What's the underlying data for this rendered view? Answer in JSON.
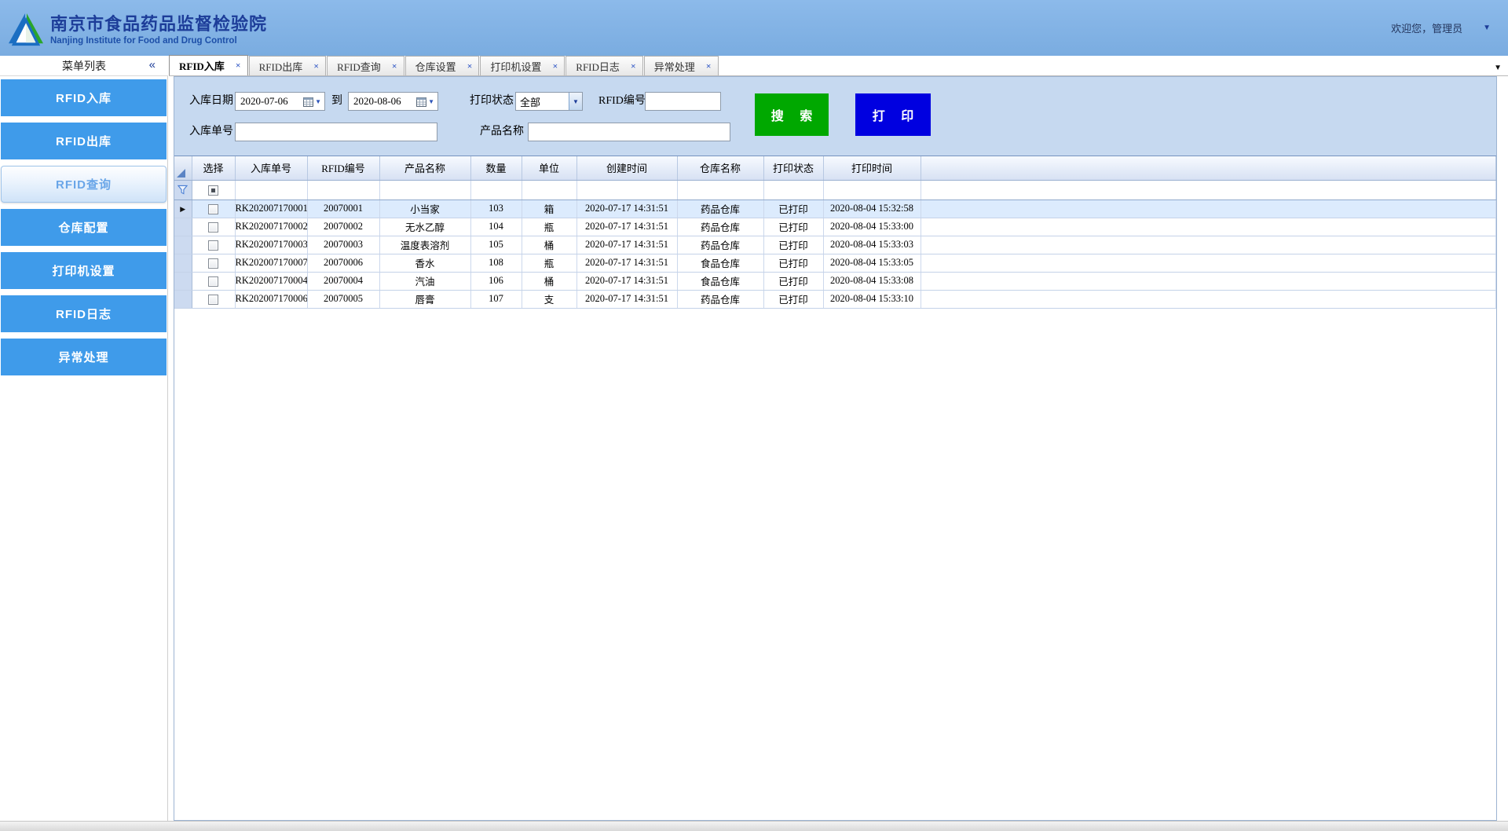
{
  "header": {
    "title": "南京市食品药品监督检验院",
    "subtitle": "Nanjing Institute for Food and Drug Control",
    "welcome": "欢迎您，管理员"
  },
  "icons": {
    "collapse": "«",
    "user_caret": "▼",
    "tab_overflow": "▼",
    "date_caret": "▼",
    "combo_caret": "▼",
    "current_row": "▶",
    "close": "×"
  },
  "sidebar": {
    "title": "菜单列表",
    "items": [
      {
        "label": "RFID入库",
        "selected": false
      },
      {
        "label": "RFID出库",
        "selected": false
      },
      {
        "label": "RFID查询",
        "selected": true
      },
      {
        "label": "仓库配置",
        "selected": false
      },
      {
        "label": "打印机设置",
        "selected": false
      },
      {
        "label": "RFID日志",
        "selected": false
      },
      {
        "label": "异常处理",
        "selected": false
      }
    ]
  },
  "tabs": [
    {
      "label": "RFID入库",
      "active": true
    },
    {
      "label": "RFID出库",
      "active": false
    },
    {
      "label": "RFID查询",
      "active": false
    },
    {
      "label": "仓库设置",
      "active": false
    },
    {
      "label": "打印机设置",
      "active": false
    },
    {
      "label": "RFID日志",
      "active": false
    },
    {
      "label": "异常处理",
      "active": false
    }
  ],
  "filters": {
    "date_label": "入库日期",
    "date_from": "2020-07-06",
    "to_label": "到",
    "date_to": "2020-08-06",
    "print_status_label": "打印状态",
    "print_status_value": "全部",
    "rfid_label": "RFID编号",
    "rfid_value": "",
    "order_label": "入库单号",
    "order_value": "",
    "product_label": "产品名称",
    "product_value": "",
    "search_button": "搜 索",
    "print_button": "打 印"
  },
  "table": {
    "columns": [
      "选择",
      "入库单号",
      "RFID编号",
      "产品名称",
      "数量",
      "单位",
      "创建时间",
      "仓库名称",
      "打印状态",
      "打印时间"
    ],
    "rows": [
      {
        "order": "RK202007170001",
        "rfid": "20070001",
        "product": "小当家",
        "qty": "103",
        "unit": "箱",
        "created": "2020-07-17 14:31:51",
        "warehouse": "药品仓库",
        "status": "已打印",
        "printed": "2020-08-04 15:32:58",
        "current": true
      },
      {
        "order": "RK202007170002",
        "rfid": "20070002",
        "product": "无水乙醇",
        "qty": "104",
        "unit": "瓶",
        "created": "2020-07-17 14:31:51",
        "warehouse": "药品仓库",
        "status": "已打印",
        "printed": "2020-08-04 15:33:00",
        "current": false
      },
      {
        "order": "RK202007170003",
        "rfid": "20070003",
        "product": "温度表溶剂",
        "qty": "105",
        "unit": "桶",
        "created": "2020-07-17 14:31:51",
        "warehouse": "药品仓库",
        "status": "已打印",
        "printed": "2020-08-04 15:33:03",
        "current": false
      },
      {
        "order": "RK202007170007",
        "rfid": "20070006",
        "product": "香水",
        "qty": "108",
        "unit": "瓶",
        "created": "2020-07-17 14:31:51",
        "warehouse": "食品仓库",
        "status": "已打印",
        "printed": "2020-08-04 15:33:05",
        "current": false
      },
      {
        "order": "RK202007170004",
        "rfid": "20070004",
        "product": "汽油",
        "qty": "106",
        "unit": "桶",
        "created": "2020-07-17 14:31:51",
        "warehouse": "食品仓库",
        "status": "已打印",
        "printed": "2020-08-04 15:33:08",
        "current": false
      },
      {
        "order": "RK202007170006",
        "rfid": "20070005",
        "product": "唇膏",
        "qty": "107",
        "unit": "支",
        "created": "2020-07-17 14:31:51",
        "warehouse": "药品仓库",
        "status": "已打印",
        "printed": "2020-08-04 15:33:10",
        "current": false
      }
    ]
  },
  "colors": {
    "header_bg": "#7fb2e5",
    "sidebar_item_blue": "#3f9bea",
    "form_panel_blue": "#c6d9f0",
    "search_button_green": "#00a800",
    "print_button_blue": "#0000e0",
    "selected_row": "#dcebfd",
    "title_text": "#1d3d99"
  }
}
